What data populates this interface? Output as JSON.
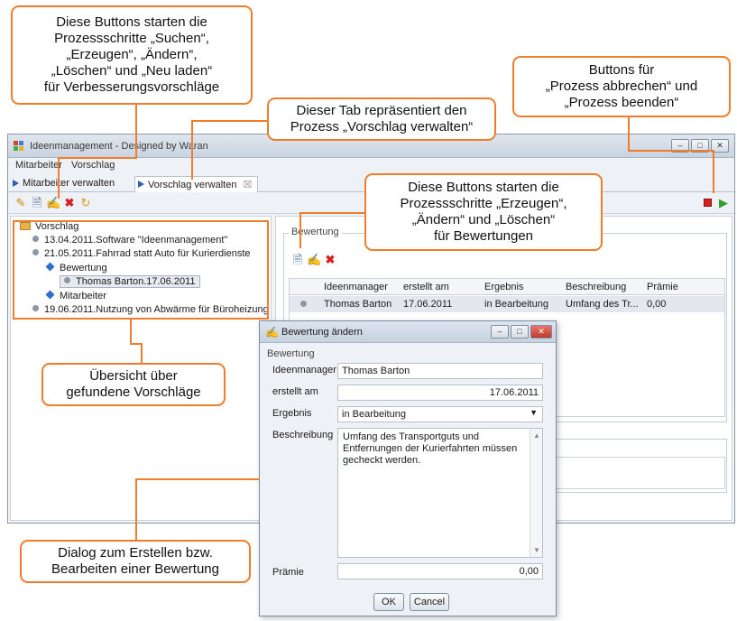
{
  "window": {
    "title": "Ideenmanagement - Designed by Waran",
    "controls": [
      "–",
      "□",
      "✕"
    ]
  },
  "menu": [
    "Mitarbeiter",
    "Vorschlag"
  ],
  "tabs": [
    {
      "label": "Mitarbeiter verwalten"
    },
    {
      "label": "Vorschlag verwalten",
      "close": "☒"
    }
  ],
  "toolbar": {
    "icons": [
      "search-icon",
      "create-icon",
      "edit-icon",
      "delete-icon",
      "reload-icon"
    ],
    "right_icons": [
      "cancel-process-icon",
      "finish-process-icon"
    ],
    "colors": {
      "delete": "#d62020",
      "stop": "#d62020",
      "play": "#2f9e2f",
      "accent": "#f07d2c"
    }
  },
  "tree": {
    "root": "Vorschlag",
    "items": [
      {
        "label": "13.04.2011.Software \"Ideenmanagement\""
      },
      {
        "label": "21.05.2011.Fahrrad statt Auto für Kurierdienste"
      },
      {
        "label": "Bewertung"
      },
      {
        "label": "Thomas Barton.17.06.2011"
      },
      {
        "label": "Mitarbeiter"
      },
      {
        "label": "19.06.2011.Nutzung von Abwärme für Büroheizung"
      }
    ]
  },
  "bewertung": {
    "group_label": "Bewertung",
    "columns": [
      "Ideenmanager",
      "erstellt am",
      "Ergebnis",
      "Beschreibung",
      "Prämie"
    ],
    "rows": [
      [
        "Thomas Barton",
        "17.06.2011",
        "in Bearbeitung",
        "Umfang des Tr...",
        "0,00"
      ]
    ]
  },
  "dialog": {
    "title": "Bewertung ändern",
    "group_label": "Bewertung",
    "fields": {
      "ideenmanager_label": "Ideenmanager",
      "ideenmanager_value": "Thomas Barton",
      "erstellt_label": "erstellt am",
      "erstellt_value": "17.06.2011",
      "ergebnis_label": "Ergebnis",
      "ergebnis_value": "in Bearbeitung",
      "beschreibung_label": "Beschreibung",
      "beschreibung_value": "Umfang des Transportguts und Entfernungen der Kurierfahrten müssen gecheckt werden.",
      "praemie_label": "Prämie",
      "praemie_value": "0,00"
    },
    "ok_label": "OK",
    "cancel_label": "Cancel"
  },
  "callouts": {
    "process_buttons": "Diese Buttons starten die\nProzessschritte „Suchen“,\n„Erzeugen“, „Ändern“,\n„Löschen“ und „Neu laden“\nfür Verbesserungsvorschläge",
    "tab": "Dieser Tab repräsentiert den\nProzess „Vorschlag verwalten“",
    "abort_finish": "Buttons für\n„Prozess abbrechen“ und\n„Prozess beenden“",
    "rating_buttons": "Diese Buttons starten die\nProzessschritte „Erzeugen“,\n„Ändern“ und „Löschen“\nfür Bewertungen",
    "overview": "Übersicht über\ngefundene Vorschläge",
    "dialog": "Dialog zum Erstellen bzw.\nBearbeiten einer Bewertung"
  }
}
